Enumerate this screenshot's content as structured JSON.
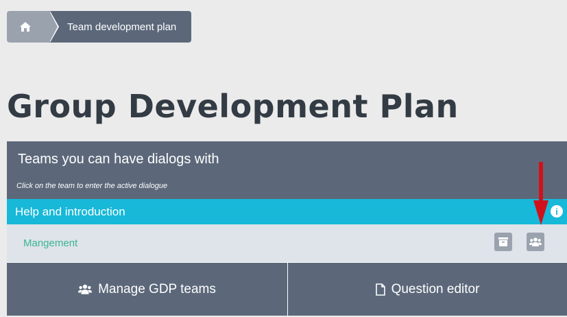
{
  "breadcrumb": {
    "home_icon": "home-icon",
    "current": "Team development plan"
  },
  "page": {
    "title": "Group Development Plan"
  },
  "panel": {
    "title": "Teams you can have dialogs with",
    "subtitle": "Click on the team to enter the active dialogue",
    "help_label": "Help and introduction",
    "help_icon": "info-icon",
    "teams": [
      {
        "name": "Mangement",
        "actions": [
          "archive-icon",
          "users-icon"
        ]
      }
    ]
  },
  "footer": {
    "manage_label": "Manage GDP teams",
    "question_label": "Question editor"
  },
  "colors": {
    "background": "#ebebeb",
    "panel": "#5c687a",
    "help_bar": "#17b8d8",
    "team_text": "#3ab592",
    "arrow": "#d0111b"
  }
}
